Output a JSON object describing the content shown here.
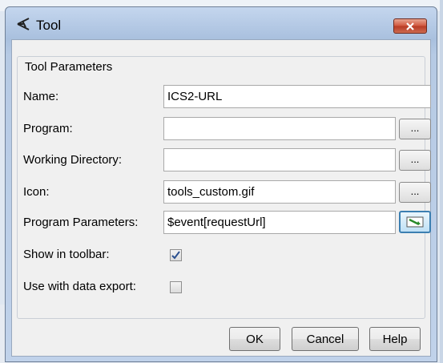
{
  "window": {
    "title": "Tool",
    "close_icon": "close-x"
  },
  "group": {
    "title": "Tool Parameters"
  },
  "fields": {
    "name": {
      "label": "Name:",
      "value": "ICS2-URL"
    },
    "program": {
      "label": "Program:",
      "value": "",
      "browse_label": "..."
    },
    "working_directory": {
      "label": "Working Directory:",
      "value": "",
      "browse_label": "..."
    },
    "icon": {
      "label": "Icon:",
      "value": "tools_custom.gif",
      "browse_label": "..."
    },
    "program_parameters": {
      "label": "Program Parameters:",
      "value": "$event[requestUrl]",
      "button_icon": "insert-variable-icon"
    },
    "show_in_toolbar": {
      "label": "Show in toolbar:",
      "checked": true
    },
    "use_with_data_export": {
      "label": "Use with data export:",
      "checked": false
    }
  },
  "buttons": {
    "ok": "OK",
    "cancel": "Cancel",
    "help": "Help"
  },
  "colors": {
    "titlebar": "#b6cae4",
    "close_button": "#d0553c",
    "dialog_bg": "#f0f0f0",
    "focus_border": "#3c7fb1"
  }
}
